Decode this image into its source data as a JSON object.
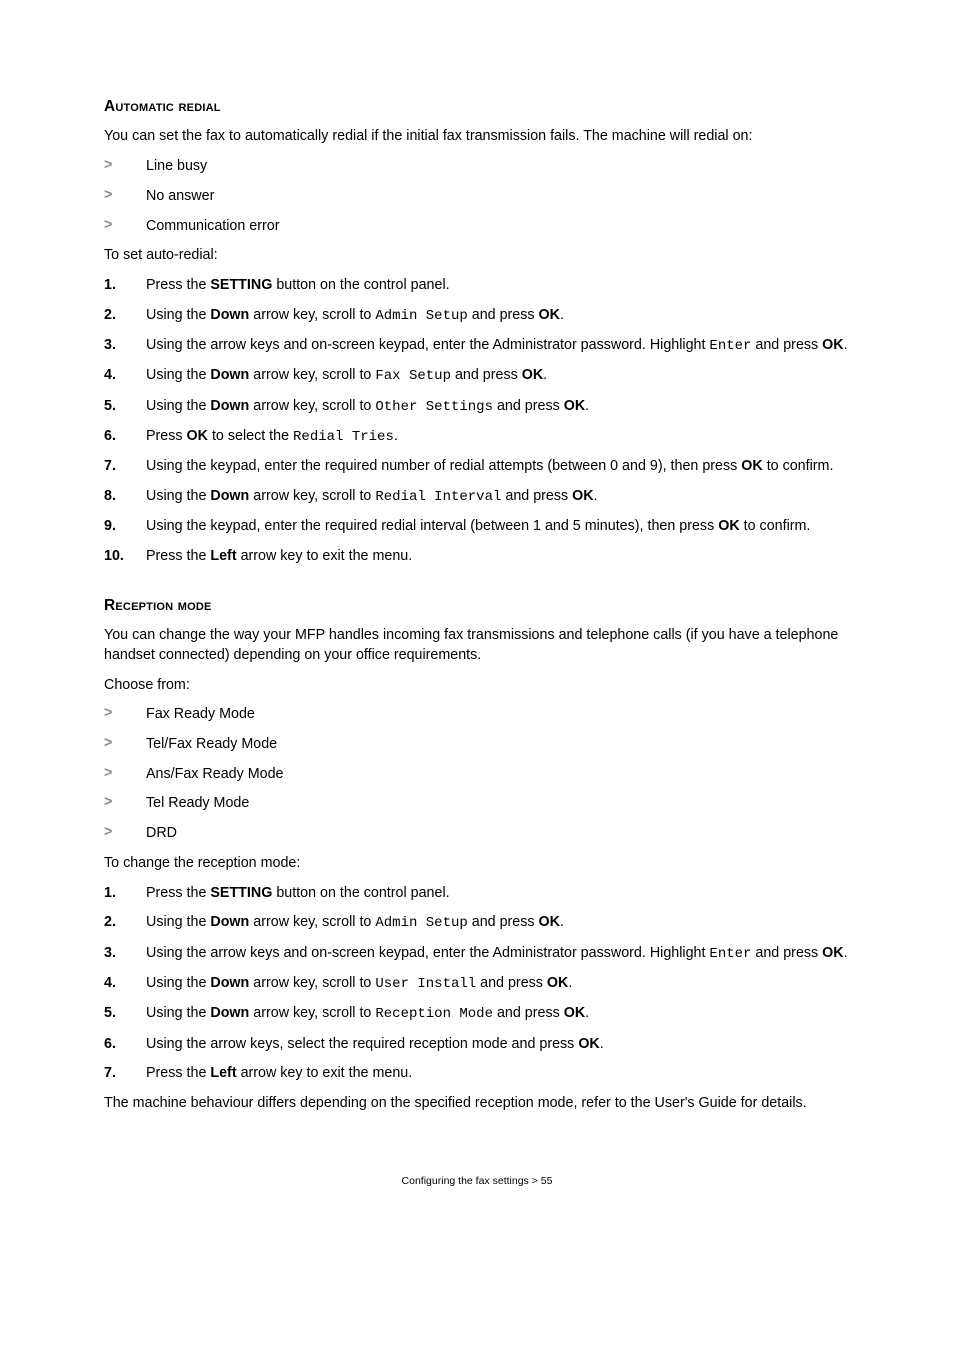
{
  "section1": {
    "heading": "Automatic redial",
    "intro": "You can set the fax to automatically redial if the initial fax transmission fails. The machine will redial on:",
    "bullets": [
      "Line busy",
      "No answer",
      "Communication error"
    ],
    "lead": "To set auto-redial:",
    "steps": [
      {
        "n": "1.",
        "parts": [
          {
            "t": "Press the "
          },
          {
            "t": "SETTING",
            "b": true
          },
          {
            "t": " button on the control panel."
          }
        ]
      },
      {
        "n": "2.",
        "parts": [
          {
            "t": "Using the "
          },
          {
            "t": "Down",
            "b": true
          },
          {
            "t": " arrow key, scroll to "
          },
          {
            "t": "Admin Setup",
            "c": true
          },
          {
            "t": " and press "
          },
          {
            "t": "OK",
            "b": true
          },
          {
            "t": "."
          }
        ]
      },
      {
        "n": "3.",
        "parts": [
          {
            "t": "Using the arrow keys and on-screen keypad, enter the Administrator password. Highlight "
          },
          {
            "t": "Enter",
            "c": true
          },
          {
            "t": " and press "
          },
          {
            "t": "OK",
            "b": true
          },
          {
            "t": "."
          }
        ]
      },
      {
        "n": "4.",
        "parts": [
          {
            "t": "Using the "
          },
          {
            "t": "Down",
            "b": true
          },
          {
            "t": " arrow key, scroll to "
          },
          {
            "t": "Fax Setup",
            "c": true
          },
          {
            "t": " and press "
          },
          {
            "t": "OK",
            "b": true
          },
          {
            "t": "."
          }
        ]
      },
      {
        "n": "5.",
        "parts": [
          {
            "t": "Using the "
          },
          {
            "t": "Down",
            "b": true
          },
          {
            "t": " arrow key, scroll to "
          },
          {
            "t": "Other Settings",
            "c": true
          },
          {
            "t": " and press "
          },
          {
            "t": "OK",
            "b": true
          },
          {
            "t": "."
          }
        ]
      },
      {
        "n": "6.",
        "parts": [
          {
            "t": "Press "
          },
          {
            "t": "OK",
            "b": true
          },
          {
            "t": " to select the "
          },
          {
            "t": "Redial Tries",
            "c": true
          },
          {
            "t": "."
          }
        ]
      },
      {
        "n": "7.",
        "parts": [
          {
            "t": "Using the keypad, enter the required number of redial attempts (between 0 and 9), then press "
          },
          {
            "t": "OK",
            "b": true
          },
          {
            "t": " to confirm."
          }
        ]
      },
      {
        "n": "8.",
        "parts": [
          {
            "t": "Using the "
          },
          {
            "t": "Down",
            "b": true
          },
          {
            "t": " arrow key, scroll to "
          },
          {
            "t": "Redial Interval",
            "c": true
          },
          {
            "t": " and press "
          },
          {
            "t": "OK",
            "b": true
          },
          {
            "t": "."
          }
        ]
      },
      {
        "n": "9.",
        "parts": [
          {
            "t": "Using the keypad, enter the required redial interval (between 1 and 5 minutes), then press "
          },
          {
            "t": "OK",
            "b": true
          },
          {
            "t": " to confirm."
          }
        ]
      },
      {
        "n": "10.",
        "parts": [
          {
            "t": "Press the "
          },
          {
            "t": "Left",
            "b": true
          },
          {
            "t": " arrow key to exit the menu."
          }
        ]
      }
    ]
  },
  "section2": {
    "heading": "Reception mode",
    "intro": "You can change the way your MFP handles incoming fax transmissions and telephone calls (if you have a telephone handset connected) depending on your office requirements.",
    "lead1": "Choose from:",
    "bullets": [
      "Fax Ready Mode",
      "Tel/Fax Ready Mode",
      "Ans/Fax Ready Mode",
      "Tel Ready Mode",
      "DRD"
    ],
    "lead2": "To change the reception mode:",
    "steps": [
      {
        "n": "1.",
        "parts": [
          {
            "t": "Press the "
          },
          {
            "t": "SETTING",
            "b": true
          },
          {
            "t": " button on the control panel."
          }
        ]
      },
      {
        "n": "2.",
        "parts": [
          {
            "t": "Using the "
          },
          {
            "t": "Down",
            "b": true
          },
          {
            "t": " arrow key, scroll to "
          },
          {
            "t": "Admin Setup",
            "c": true
          },
          {
            "t": " and press "
          },
          {
            "t": "OK",
            "b": true
          },
          {
            "t": "."
          }
        ]
      },
      {
        "n": "3.",
        "parts": [
          {
            "t": "Using the arrow keys and on-screen keypad, enter the Administrator password. Highlight "
          },
          {
            "t": "Enter",
            "c": true
          },
          {
            "t": " and press "
          },
          {
            "t": "OK",
            "b": true
          },
          {
            "t": "."
          }
        ]
      },
      {
        "n": "4.",
        "parts": [
          {
            "t": "Using the "
          },
          {
            "t": "Down",
            "b": true
          },
          {
            "t": " arrow key, scroll to "
          },
          {
            "t": "User Install",
            "c": true
          },
          {
            "t": " and press "
          },
          {
            "t": "OK",
            "b": true
          },
          {
            "t": "."
          }
        ]
      },
      {
        "n": "5.",
        "parts": [
          {
            "t": "Using the "
          },
          {
            "t": "Down",
            "b": true
          },
          {
            "t": " arrow key, scroll to "
          },
          {
            "t": "Reception Mode",
            "c": true
          },
          {
            "t": " and press "
          },
          {
            "t": "OK",
            "b": true
          },
          {
            "t": "."
          }
        ]
      },
      {
        "n": "6.",
        "parts": [
          {
            "t": "Using the arrow keys, select the required reception mode and press "
          },
          {
            "t": "OK",
            "b": true
          },
          {
            "t": "."
          }
        ]
      },
      {
        "n": "7.",
        "parts": [
          {
            "t": "Press the "
          },
          {
            "t": "Left",
            "b": true
          },
          {
            "t": " arrow key to exit the menu."
          }
        ]
      }
    ],
    "outro": "The machine behaviour differs depending on the specified reception mode, refer to the User's Guide for details."
  },
  "footer": "Configuring the fax settings > 55",
  "glyphs": {
    "chevron": ">"
  }
}
